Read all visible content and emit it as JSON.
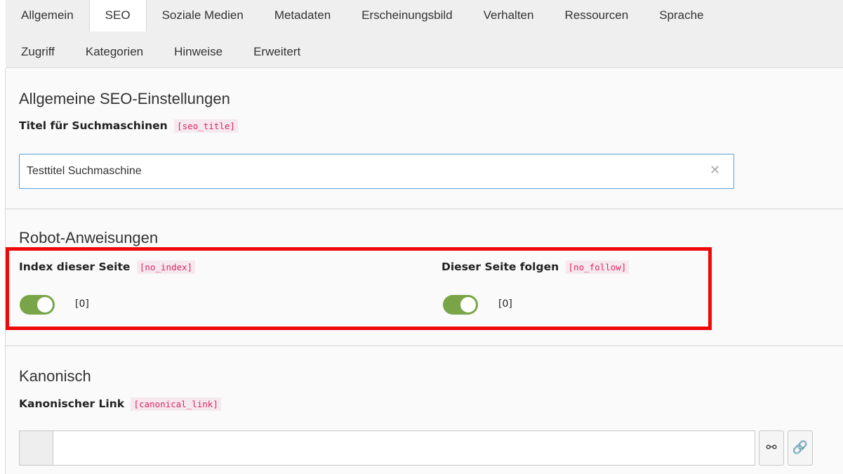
{
  "tabs": {
    "row1": [
      "Allgemein",
      "SEO",
      "Soziale Medien",
      "Metadaten",
      "Erscheinungsbild",
      "Verhalten",
      "Ressourcen",
      "Sprache"
    ],
    "row2": [
      "Zugriff",
      "Kategorien",
      "Hinweise",
      "Erweitert"
    ],
    "active": "SEO"
  },
  "seo_section": {
    "title": "Allgemeine SEO-Einstellungen",
    "seo_title_label": "Titel für Suchmaschinen",
    "seo_title_code": "[seo_title]",
    "seo_title_value": "Testtitel Suchmaschine"
  },
  "robots_section": {
    "title": "Robot-Anweisungen",
    "no_index_label": "Index dieser Seite",
    "no_index_code": "[no_index]",
    "no_index_value": "[0]",
    "no_follow_label": "Dieser Seite folgen",
    "no_follow_code": "[no_follow]",
    "no_follow_value": "[0]"
  },
  "canonical_section": {
    "title": "Kanonisch",
    "link_label": "Kanonischer Link",
    "link_code": "[canonical_link]"
  },
  "colors": {
    "toggle_on": "#79a548",
    "highlight": "#ef0a0a",
    "code_text": "#e0245e",
    "input_focus": "#5aa0d8"
  },
  "icons": [
    "clear-icon",
    "unlink-icon",
    "link-icon"
  ]
}
